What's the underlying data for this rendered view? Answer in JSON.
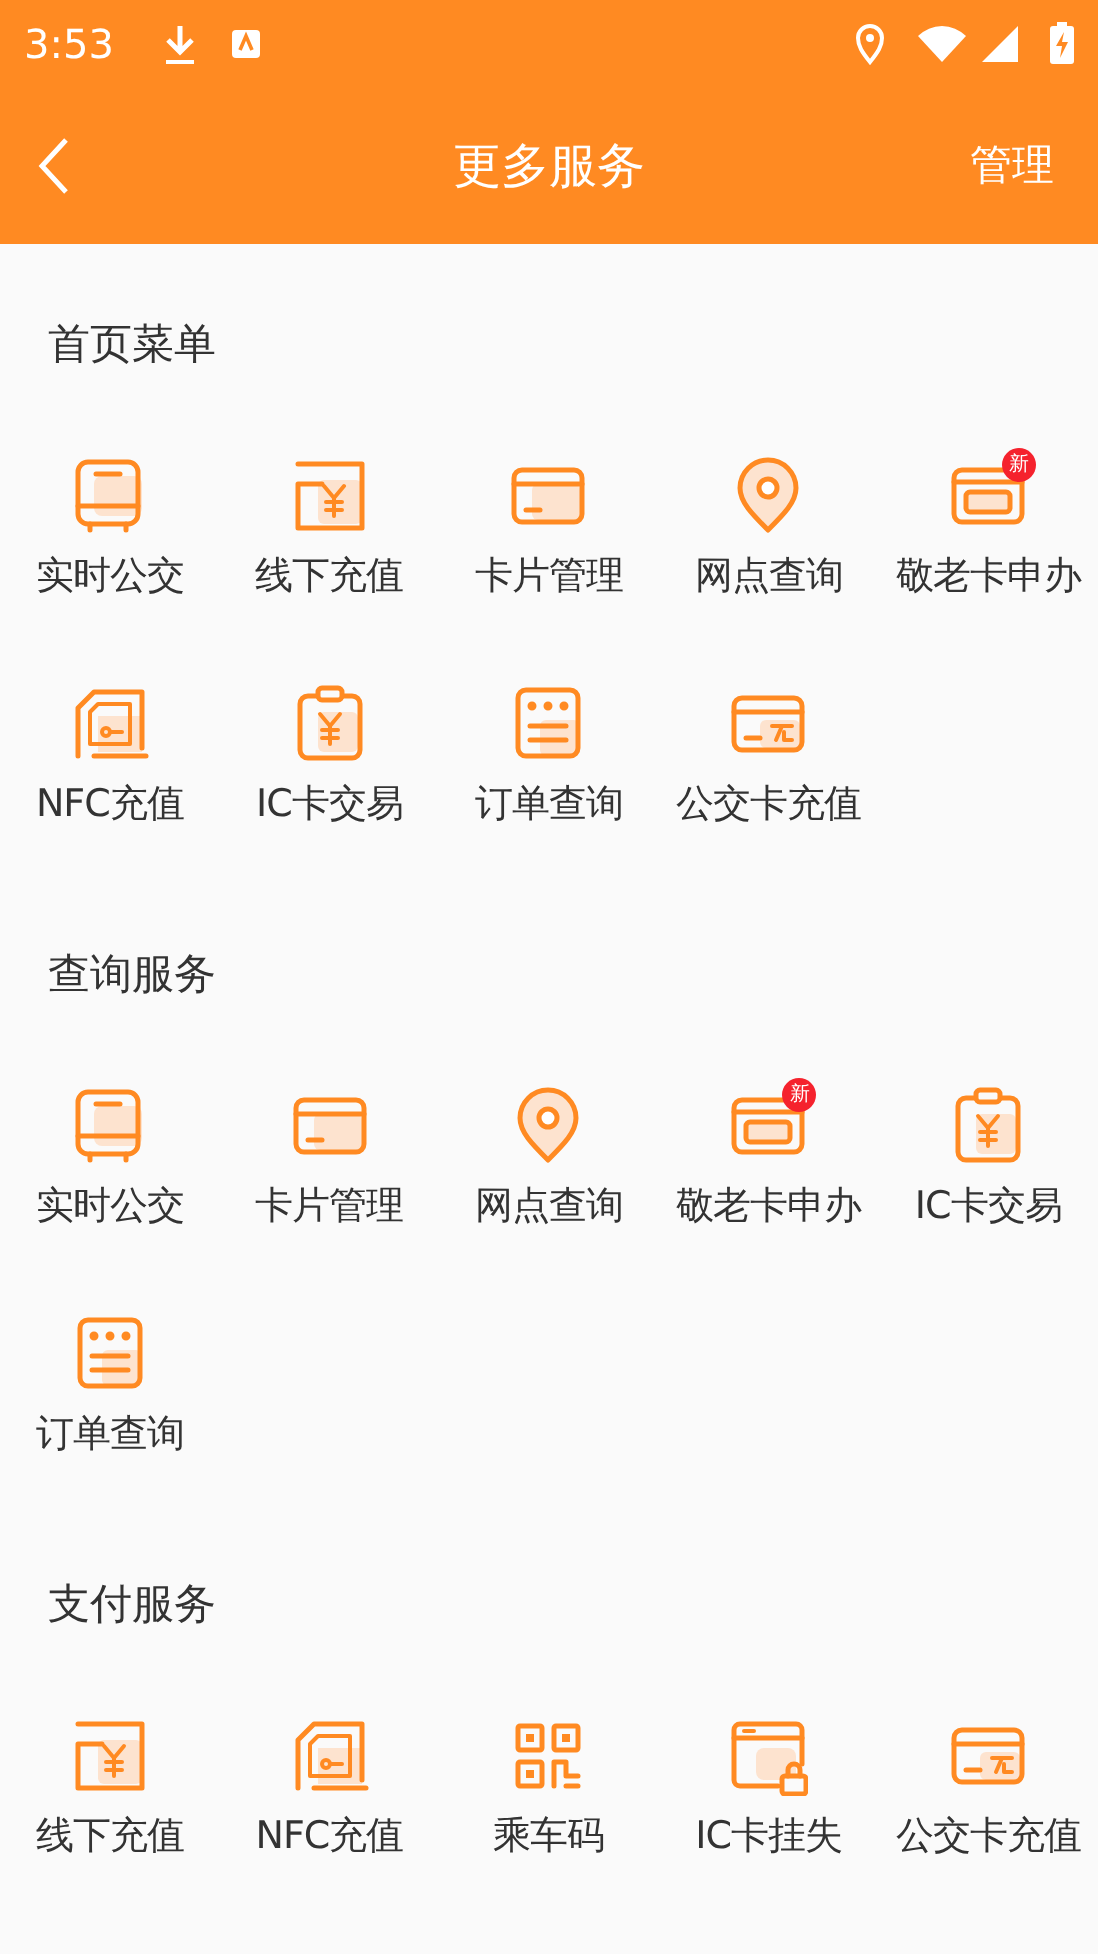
{
  "status_bar": {
    "time": "3:53"
  },
  "header": {
    "title": "更多服务",
    "action": "管理"
  },
  "sections": [
    {
      "title": "首页菜单",
      "items": [
        {
          "kind": "bus",
          "label": "实时公交"
        },
        {
          "kind": "cash",
          "label": "线下充值"
        },
        {
          "kind": "card",
          "label": "卡片管理"
        },
        {
          "kind": "location",
          "label": "网点查询"
        },
        {
          "kind": "elder",
          "label": "敬老卡申办",
          "badge": "新"
        },
        {
          "kind": "nfc",
          "label": "NFC充值"
        },
        {
          "kind": "receipt",
          "label": "IC卡交易"
        },
        {
          "kind": "order",
          "label": "订单查询"
        },
        {
          "kind": "recharge",
          "label": "公交卡充值"
        }
      ]
    },
    {
      "title": "查询服务",
      "items": [
        {
          "kind": "bus",
          "label": "实时公交"
        },
        {
          "kind": "card",
          "label": "卡片管理"
        },
        {
          "kind": "location",
          "label": "网点查询"
        },
        {
          "kind": "elder",
          "label": "敬老卡申办",
          "badge": "新"
        },
        {
          "kind": "receipt",
          "label": "IC卡交易"
        },
        {
          "kind": "order",
          "label": "订单查询"
        }
      ]
    },
    {
      "title": "支付服务",
      "items": [
        {
          "kind": "cash",
          "label": "线下充值"
        },
        {
          "kind": "nfc",
          "label": "NFC充值"
        },
        {
          "kind": "qr",
          "label": "乘车码"
        },
        {
          "kind": "lock",
          "label": "IC卡挂失"
        },
        {
          "kind": "recharge",
          "label": "公交卡充值"
        }
      ]
    }
  ]
}
